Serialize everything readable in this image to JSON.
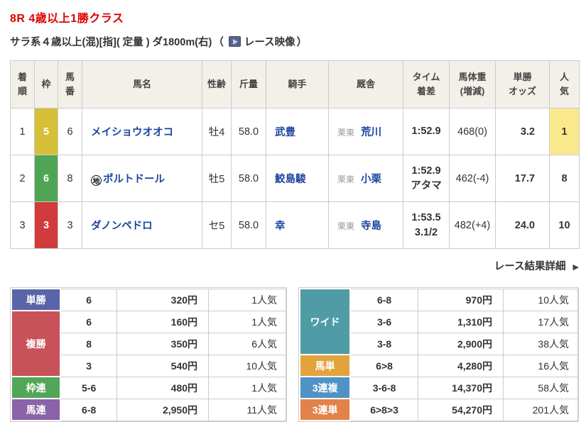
{
  "header": {
    "title": "8R 4歳以上1勝クラス",
    "conditions": "サラ系４歳以上(混)[指]( 定量 ) ダ1800m(右)",
    "paren_open": "（",
    "video_label": "レース映像",
    "paren_close": "）"
  },
  "results": {
    "columns": [
      [
        "着",
        "順"
      ],
      [
        "枠"
      ],
      [
        "馬",
        "番"
      ],
      [
        "馬名"
      ],
      [
        "性齢"
      ],
      [
        "斤量"
      ],
      [
        "騎手"
      ],
      [
        "厩舎"
      ],
      [
        "タイム",
        "着差"
      ],
      [
        "馬体重",
        "(増減)"
      ],
      [
        "単勝",
        "オッズ"
      ],
      [
        "人",
        "気"
      ]
    ],
    "rows": [
      {
        "position": "1",
        "frame": "5",
        "frame_color": "#d5c037",
        "number": "6",
        "horse": "メイショウオオコ",
        "sex_age": "牡4",
        "weight": "58.0",
        "jockey": "武豊",
        "region": "栗東",
        "trainer": "荒川",
        "time": "1:52.9",
        "margin": "",
        "body_weight": "468(0)",
        "odds": "3.2",
        "popularity": "1",
        "popularity_bg": "#fae98c"
      },
      {
        "position": "2",
        "frame": "6",
        "frame_color": "#4fa553",
        "number": "8",
        "horse": "ポルトドール",
        "mark": "地",
        "sex_age": "牡5",
        "weight": "58.0",
        "jockey": "鮫島駿",
        "region": "栗東",
        "trainer": "小栗",
        "time": "1:52.9",
        "margin": "アタマ",
        "body_weight": "462(-4)",
        "odds": "17.7",
        "popularity": "8",
        "popularity_bg": "#ffffff"
      },
      {
        "position": "3",
        "frame": "3",
        "frame_color": "#d13b3b",
        "number": "3",
        "horse": "ダノンペドロ",
        "sex_age": "セ5",
        "weight": "58.0",
        "jockey": "幸",
        "region": "栗東",
        "trainer": "寺島",
        "time": "1:53.5",
        "margin": "3.1/2",
        "body_weight": "482(+4)",
        "odds": "24.0",
        "popularity": "10",
        "popularity_bg": "#ffffff"
      }
    ]
  },
  "detail_link": {
    "label": "レース結果詳細",
    "arrow": "▶"
  },
  "payouts": {
    "left": [
      {
        "label": "単勝",
        "color": "#5a64a8",
        "rows": [
          {
            "combo": "6",
            "amount": "320円",
            "pop": "1人気"
          }
        ]
      },
      {
        "label": "複勝",
        "color": "#c75259",
        "rows": [
          {
            "combo": "6",
            "amount": "160円",
            "pop": "1人気"
          },
          {
            "combo": "8",
            "amount": "350円",
            "pop": "6人気"
          },
          {
            "combo": "3",
            "amount": "540円",
            "pop": "10人気"
          }
        ]
      },
      {
        "label": "枠連",
        "color": "#51a757",
        "rows": [
          {
            "combo": "5-6",
            "amount": "480円",
            "pop": "1人気"
          }
        ]
      },
      {
        "label": "馬連",
        "color": "#8a63a8",
        "rows": [
          {
            "combo": "6-8",
            "amount": "2,950円",
            "pop": "11人気"
          }
        ]
      }
    ],
    "right": [
      {
        "label": "ワイド",
        "color": "#4f9ca6",
        "rows": [
          {
            "combo": "6-8",
            "amount": "970円",
            "pop": "10人気"
          },
          {
            "combo": "3-6",
            "amount": "1,310円",
            "pop": "17人気"
          },
          {
            "combo": "3-8",
            "amount": "2,900円",
            "pop": "38人気"
          }
        ]
      },
      {
        "label": "馬単",
        "color": "#e2a33c",
        "rows": [
          {
            "combo": "6>8",
            "amount": "4,280円",
            "pop": "16人気"
          }
        ]
      },
      {
        "label": "3連複",
        "color": "#4f93c6",
        "rows": [
          {
            "combo": "3-6-8",
            "amount": "14,370円",
            "pop": "58人気"
          }
        ]
      },
      {
        "label": "3連単",
        "color": "#e2824a",
        "rows": [
          {
            "combo": "6>8>3",
            "amount": "54,270円",
            "pop": "201人気"
          }
        ]
      }
    ]
  },
  "colors": {
    "title_red": "#dd0000",
    "link_blue": "#1b459e",
    "header_beige": "#f3f0e9",
    "favorite_highlight": "#fae98c"
  }
}
